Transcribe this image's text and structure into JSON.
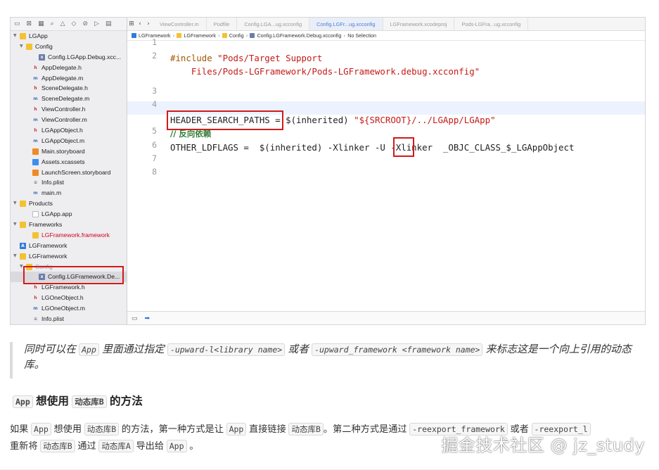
{
  "navigator": {
    "toolbar_icons": [
      "folder-icon",
      "source-control-icon",
      "symbol-icon",
      "find-icon",
      "issue-icon",
      "test-icon",
      "debug-icon",
      "breakpoint-icon",
      "report-icon"
    ],
    "tree": [
      {
        "label": "LGApp",
        "indent": 0,
        "icon": "folder",
        "disclosure": "open"
      },
      {
        "label": "Config",
        "indent": 1,
        "icon": "folder",
        "disclosure": "open"
      },
      {
        "label": "Config.LGApp.Debug.xcc...",
        "indent": 3,
        "icon": "xc"
      },
      {
        "label": "AppDelegate.h",
        "indent": 2,
        "icon": "h"
      },
      {
        "label": "AppDelegate.m",
        "indent": 2,
        "icon": "m"
      },
      {
        "label": "SceneDelegate.h",
        "indent": 2,
        "icon": "h"
      },
      {
        "label": "SceneDelegate.m",
        "indent": 2,
        "icon": "m"
      },
      {
        "label": "ViewController.h",
        "indent": 2,
        "icon": "h"
      },
      {
        "label": "ViewController.m",
        "indent": 2,
        "icon": "m"
      },
      {
        "label": "LGAppObject.h",
        "indent": 2,
        "icon": "h"
      },
      {
        "label": "LGAppObject.m",
        "indent": 2,
        "icon": "m"
      },
      {
        "label": "Main.storyboard",
        "indent": 2,
        "icon": "sb"
      },
      {
        "label": "Assets.xcassets",
        "indent": 2,
        "icon": "assets"
      },
      {
        "label": "LaunchScreen.storyboard",
        "indent": 2,
        "icon": "sb"
      },
      {
        "label": "Info.plist",
        "indent": 2,
        "icon": "plist"
      },
      {
        "label": "main.m",
        "indent": 2,
        "icon": "m"
      },
      {
        "label": "Products",
        "indent": 0,
        "icon": "folder",
        "disclosure": "open"
      },
      {
        "label": "LGApp.app",
        "indent": 2,
        "icon": "app"
      },
      {
        "label": "Frameworks",
        "indent": 0,
        "icon": "folder",
        "disclosure": "open"
      },
      {
        "label": "LGFramework.framework",
        "indent": 2,
        "icon": "fw",
        "red": true
      },
      {
        "label": "LGFramework",
        "indent": 0,
        "icon": "proj",
        "project": true
      },
      {
        "label": "LGFramework",
        "indent": 0,
        "icon": "folder",
        "disclosure": "open"
      },
      {
        "label": "Config",
        "indent": 1,
        "icon": "folder",
        "disclosure": "open",
        "dim": true
      },
      {
        "label": "Config.LGFramework.De...",
        "indent": 3,
        "icon": "xc",
        "selected": true
      },
      {
        "label": "LGFramework.h",
        "indent": 2,
        "icon": "h"
      },
      {
        "label": "LGOneObject.h",
        "indent": 2,
        "icon": "h"
      },
      {
        "label": "LGOneObject.m",
        "indent": 2,
        "icon": "m"
      },
      {
        "label": "Info.plist",
        "indent": 2,
        "icon": "plist"
      }
    ]
  },
  "editor": {
    "tabs": [
      {
        "label": "ViewController.m",
        "active": false
      },
      {
        "label": "Podfile",
        "active": false
      },
      {
        "label": "Config.LGA...ug.xcconfig",
        "active": false
      },
      {
        "label": "Config.LGFr...ug.xcconfig",
        "active": true
      },
      {
        "label": "LGFramework.xcodeproj",
        "active": false
      },
      {
        "label": "Pods-LGFra...ug.xcconfig",
        "active": false
      }
    ],
    "jumpbar": [
      "LGFramework",
      "LGFramework",
      "Config",
      "Config.LGFramework.Debug.xcconfig",
      "No Selection"
    ],
    "line_numbers": [
      "1",
      "2",
      "",
      "3",
      "4",
      "",
      "5",
      "6",
      "7",
      "8"
    ],
    "code": {
      "include_kw": "#include",
      "include_path_1": "\"Pods/Target Support",
      "include_path_2": "Files/Pods-LGFramework/Pods-LGFramework.debug.xcconfig\"",
      "header_key": "HEADER_SEARCH_PATHS",
      "header_eq": " = $(inherited) ",
      "header_val": "\"${SRCROOT}/../LGApp/LGApp\"",
      "comment": "// 反向依赖",
      "ldflags_pre": "OTHER_LDFLAGS =  $(inherited) -Xlinker ",
      "ldflags_u": "-U",
      "ldflags_post": " -Xlinker  _OBJC_CLASS_$_LGAppObject"
    }
  },
  "article": {
    "quote": {
      "t1": "同时可以在",
      "c1": "App",
      "t2": "里面通过指定",
      "c2": "-upward-l<library name>",
      "t3": "或者",
      "c3": "-upward_framework <framework name>",
      "t4": "来标志这是一个向上引用的动态库。"
    },
    "heading": {
      "c1": "App",
      "t1": "想使用",
      "c2": "动态库B",
      "t2": "的方法"
    },
    "para": {
      "t1": "如果",
      "c1": "App",
      "t2": "想使用",
      "c2": "动态库B",
      "t3": "的方法，第一种方式是让",
      "c3": "App",
      "t4": "直接链接",
      "c4": "动态库B",
      "t5": "。第二种方式是通过",
      "c5": "-reexport_framework",
      "t6": "或者",
      "c6": "-reexport_l",
      "t7": "重新将",
      "c7": "动态库B",
      "t8": "通过",
      "c8": "动态库A",
      "t9": "导出给",
      "c9": "App",
      "t10": "。"
    },
    "watermark": "掘金技术社区 @ jz_study"
  },
  "colors": {
    "highlight_red": "#d21a1a",
    "string_red": "#c41a16",
    "keyword_brown": "#a35600",
    "comment_green": "#2f7d32",
    "selection_bg": "#d9d9de",
    "active_tab": "#4a7fd6"
  }
}
